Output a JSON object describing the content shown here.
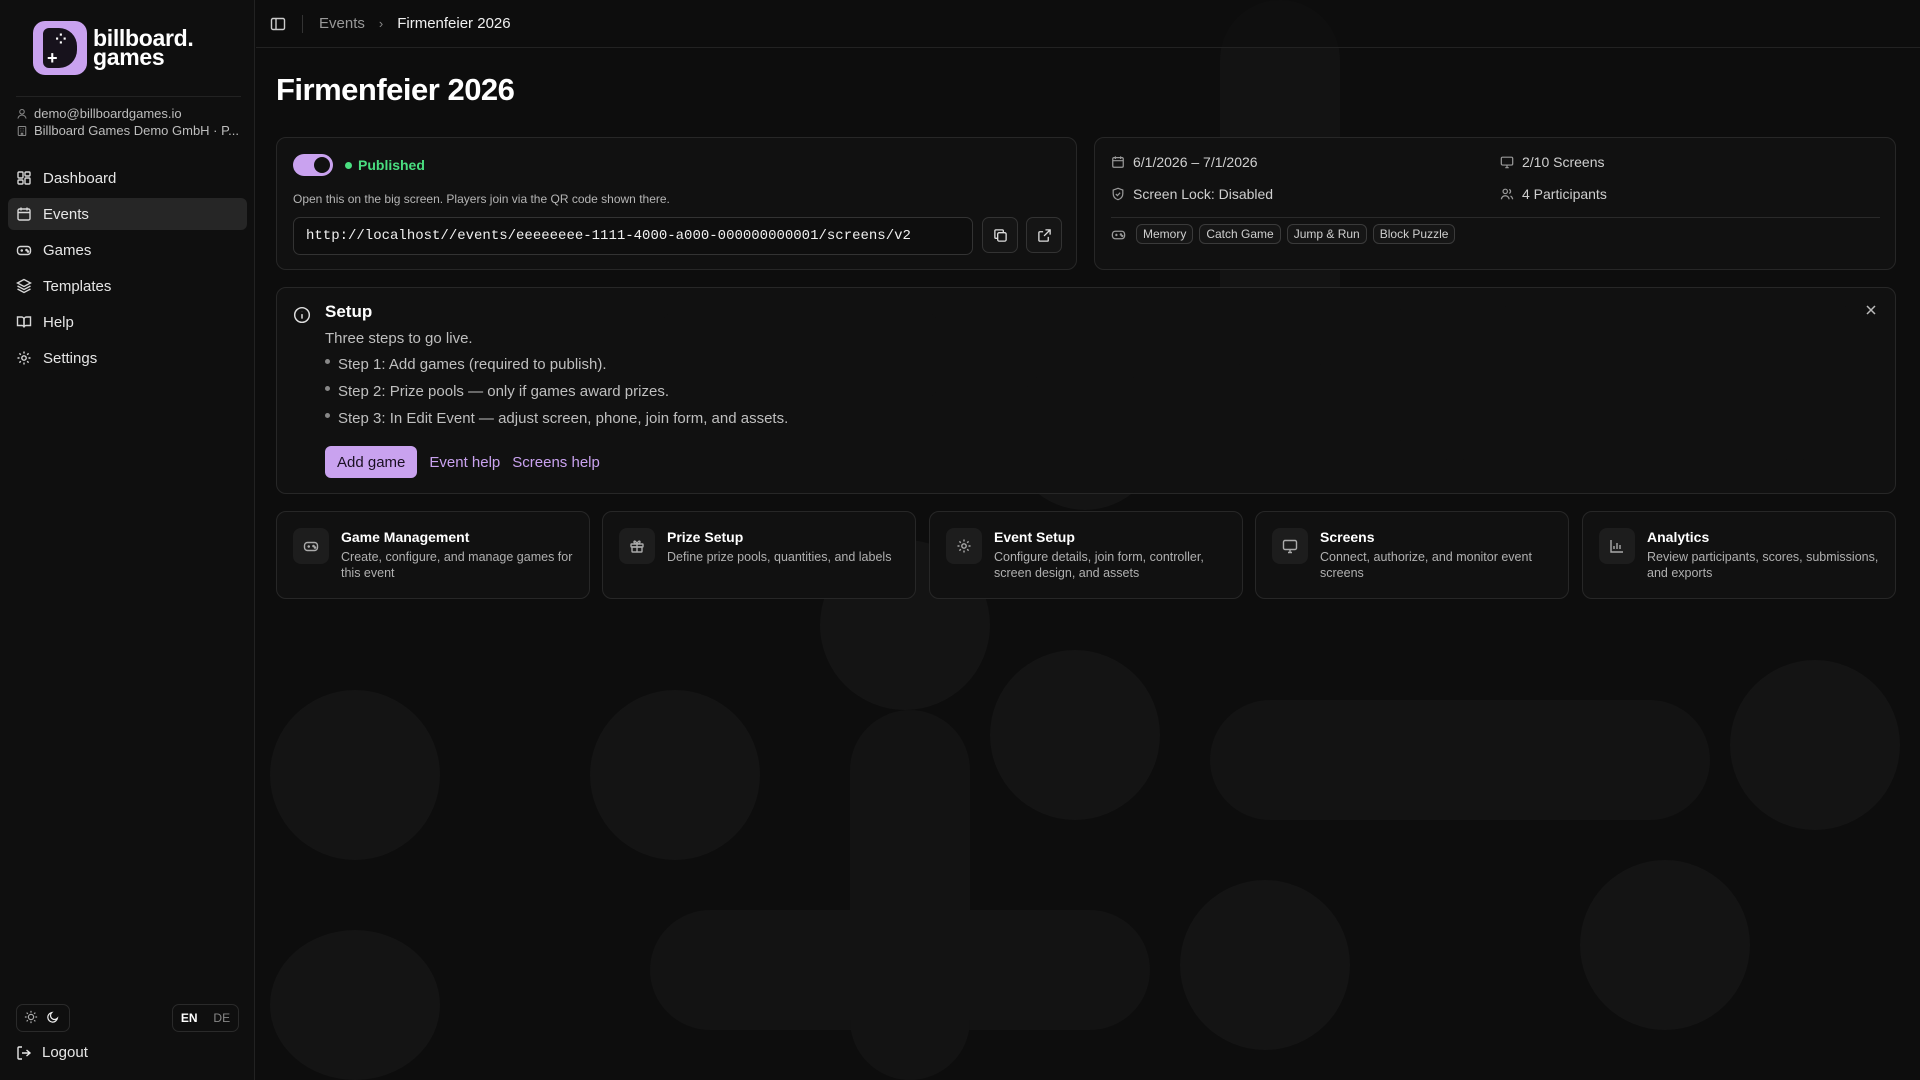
{
  "brand": {
    "name_line1": "billboard.",
    "name_line2": "games"
  },
  "account": {
    "email": "demo@billboardgames.io",
    "org": "Billboard Games Demo GmbH · P..."
  },
  "nav": {
    "items": [
      {
        "label": "Dashboard",
        "icon": "dashboard-icon"
      },
      {
        "label": "Events",
        "icon": "calendar-icon",
        "active": true
      },
      {
        "label": "Games",
        "icon": "gamepad-icon"
      },
      {
        "label": "Templates",
        "icon": "layers-icon"
      },
      {
        "label": "Help",
        "icon": "book-icon"
      },
      {
        "label": "Settings",
        "icon": "gear-icon"
      }
    ]
  },
  "language": {
    "en": "EN",
    "de": "DE",
    "active": "EN"
  },
  "logout_label": "Logout",
  "breadcrumb": {
    "parent": "Events",
    "current": "Firmenfeier 2026"
  },
  "page": {
    "title": "Firmenfeier 2026"
  },
  "publish": {
    "enabled": true,
    "status": "Published",
    "hint": "Open this on the big screen. Players join via the QR code shown there.",
    "url": "http://localhost//events/eeeeeeee-1111-4000-a000-000000000001/screens/v2"
  },
  "event_info": {
    "dates": "6/1/2026 – 7/1/2026",
    "screens": "2/10 Screens",
    "screen_lock": "Screen Lock: Disabled",
    "participants": "4 Participants",
    "games": [
      "Memory",
      "Catch Game",
      "Jump & Run",
      "Block Puzzle"
    ]
  },
  "setup": {
    "title": "Setup",
    "subtitle": "Three steps to go live.",
    "steps": [
      "Step 1: Add games (required to publish).",
      "Step 2: Prize pools — only if games award prizes.",
      "Step 3: In Edit Event — adjust screen, phone, join form, and assets."
    ],
    "add_game": "Add game",
    "event_help": "Event help",
    "screens_help": "Screens help"
  },
  "features": [
    {
      "title": "Game Management",
      "desc": "Create, configure, and manage games for this event",
      "icon": "gamepad-icon"
    },
    {
      "title": "Prize Setup",
      "desc": "Define prize pools, quantities, and labels",
      "icon": "gift-icon"
    },
    {
      "title": "Event Setup",
      "desc": "Configure details, join form, controller, screen design, and assets",
      "icon": "gear-icon"
    },
    {
      "title": "Screens",
      "desc": "Connect, authorize, and monitor event screens",
      "icon": "monitor-icon"
    },
    {
      "title": "Analytics",
      "desc": "Review participants, scores, submissions, and exports",
      "icon": "bar-chart-icon"
    }
  ],
  "colors": {
    "accent": "#c9a2ef",
    "success": "#4ade80",
    "background": "#0d0d0d"
  }
}
